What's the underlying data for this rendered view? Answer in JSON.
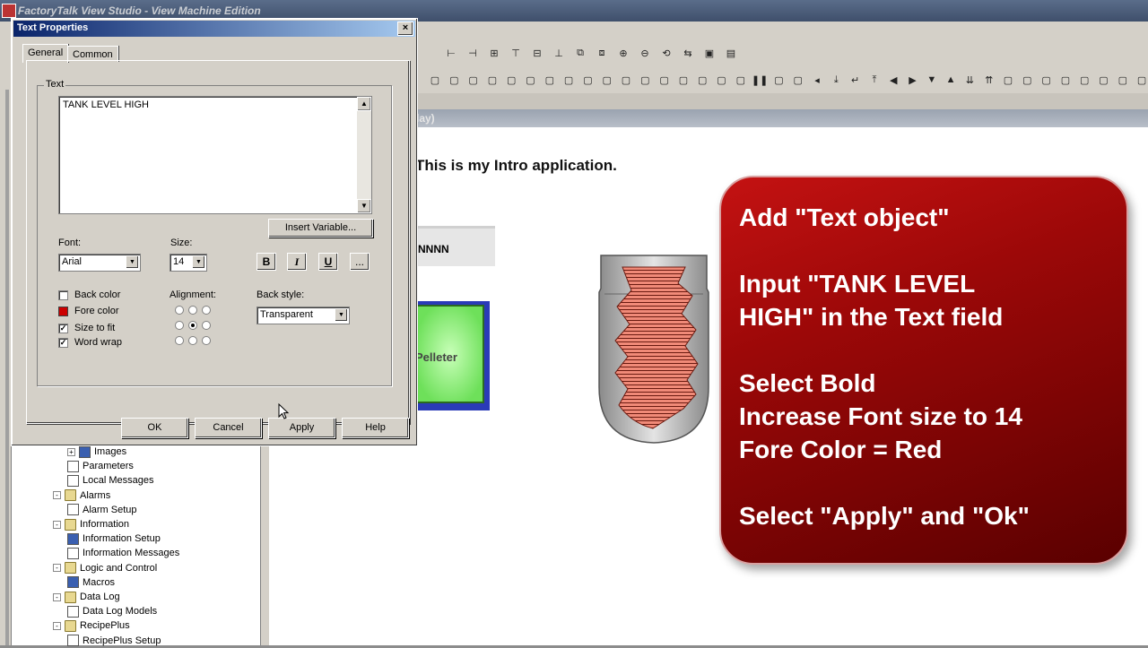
{
  "app": {
    "title": "FactoryTalk View Studio - View Machine Edition"
  },
  "display_title": "lay)",
  "canvas": {
    "intro_text": "This is my Intro application.",
    "numeric_display": "NNNN",
    "pelleter_label": "Pelleter"
  },
  "tree": [
    {
      "label": "Images",
      "indent": 1,
      "icon": "images-icon",
      "expander": "+"
    },
    {
      "label": "Parameters",
      "indent": 1,
      "icon": "parameters-icon"
    },
    {
      "label": "Local Messages",
      "indent": 1,
      "icon": "local-messages-icon"
    },
    {
      "label": "Alarms",
      "indent": 0,
      "icon": "folder-icon",
      "expander": "-"
    },
    {
      "label": "Alarm Setup",
      "indent": 1,
      "icon": "alarm-setup-icon"
    },
    {
      "label": "Information",
      "indent": 0,
      "icon": "folder-icon",
      "expander": "-"
    },
    {
      "label": "Information Setup",
      "indent": 1,
      "icon": "information-setup-icon"
    },
    {
      "label": "Information Messages",
      "indent": 1,
      "icon": "information-messages-icon"
    },
    {
      "label": "Logic and Control",
      "indent": 0,
      "icon": "folder-icon",
      "expander": "-"
    },
    {
      "label": "Macros",
      "indent": 1,
      "icon": "macros-icon"
    },
    {
      "label": "Data Log",
      "indent": 0,
      "icon": "folder-icon",
      "expander": "-"
    },
    {
      "label": "Data Log Models",
      "indent": 1,
      "icon": "data-log-models-icon"
    },
    {
      "label": "RecipePlus",
      "indent": 0,
      "icon": "folder-icon",
      "expander": "-"
    },
    {
      "label": "RecipePlus Setup",
      "indent": 1,
      "icon": "recipeplus-setup-icon"
    }
  ],
  "dialog": {
    "title": "Text Properties",
    "close_label": "×",
    "tabs": [
      "General",
      "Common"
    ],
    "active_tab": "General",
    "text_group_label": "Text",
    "text_value": "TANK LEVEL HIGH",
    "insert_variable_label": "Insert Variable...",
    "font_label": "Font:",
    "font_value": "Arial",
    "size_label": "Size:",
    "size_value": "14",
    "bold_label": "B",
    "italic_label": "I",
    "underline_label": "U",
    "more_label": "...",
    "back_color_label": "Back color",
    "fore_color_label": "Fore color",
    "size_to_fit_label": "Size to fit",
    "word_wrap_label": "Word wrap",
    "back_color_checked": false,
    "fore_color": "#cc0000",
    "size_to_fit_checked": true,
    "word_wrap_checked": true,
    "alignment_label": "Alignment:",
    "alignment_selected": "middle-center",
    "back_style_label": "Back style:",
    "back_style_value": "Transparent",
    "ok_label": "OK",
    "cancel_label": "Cancel",
    "apply_label": "Apply",
    "help_label": "Help"
  },
  "callout": {
    "lines": [
      "Add \"Text object\"",
      "",
      "Input \"TANK LEVEL",
      "HIGH\" in the Text field",
      "",
      "Select Bold",
      "Increase Font size to 14",
      "Fore Color = Red",
      "",
      "Select \"Apply\" and \"Ok\""
    ],
    "background": "#a50a0a"
  },
  "toolbar1_icons": [
    "align-left-icon",
    "align-center-icon",
    "align-right-icon",
    "align-top-icon",
    "align-middle-icon",
    "align-bottom-icon",
    "bring-front-icon",
    "send-back-icon",
    "zoom-in-icon",
    "zoom-out-icon",
    "rotate-icon",
    "flip-icon",
    "properties-icon",
    "animation-icon"
  ],
  "toolbar2_icons": [
    "object-1-icon",
    "object-2-icon",
    "object-3-icon",
    "object-4-icon",
    "object-5-icon",
    "object-6-icon",
    "object-7-icon",
    "object-8-icon",
    "object-9-icon",
    "object-10-icon",
    "object-11-icon",
    "object-12-icon",
    "object-13-icon",
    "object-14-icon",
    "object-15-icon",
    "object-16-icon",
    "object-17-icon",
    "pause-icon",
    "graph-1-icon",
    "graph-2-icon",
    "arrow-left-icon",
    "arrow-down-end-icon",
    "arrow-return-icon",
    "arrow-up-end-icon",
    "triangle-left-icon",
    "triangle-right-icon",
    "triangle-down-icon",
    "triangle-up-icon",
    "double-down-icon",
    "double-up-icon",
    "object-18-icon",
    "object-19-icon",
    "object-20-icon",
    "object-21-icon",
    "object-22-icon",
    "object-23-icon",
    "object-24-icon",
    "object-25-icon"
  ]
}
